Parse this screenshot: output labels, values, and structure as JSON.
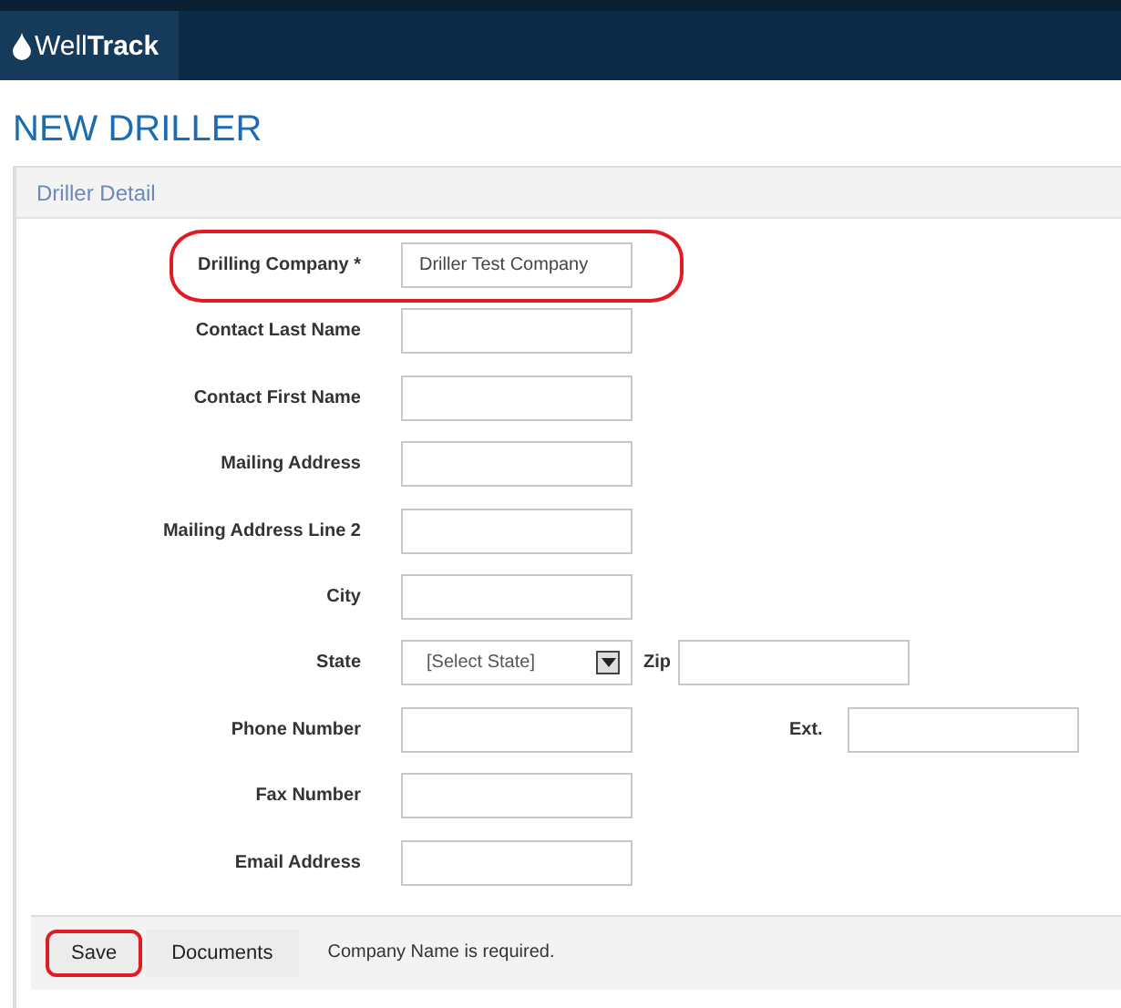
{
  "header": {
    "logo_plain": "Well",
    "logo_bold": "Track"
  },
  "page_title": "NEW DRILLER",
  "panel": {
    "title": "Driller Detail",
    "fields": [
      {
        "label": "Drilling Company *",
        "kind": "text",
        "value": "Driller Test Company",
        "highlighted": true
      },
      {
        "label": "Contact Last Name",
        "kind": "text",
        "highlighted": false
      },
      {
        "label": "Contact First Name",
        "kind": "text",
        "highlighted": false
      },
      {
        "label": "Mailing Address",
        "kind": "text",
        "highlighted": false
      },
      {
        "label": "Mailing Address Line 2",
        "kind": "text",
        "highlighted": false
      },
      {
        "label": "City",
        "kind": "text",
        "highlighted": false
      },
      {
        "label": "State",
        "kind": "select",
        "value": "[Select State]",
        "highlighted": false,
        "extra": {
          "label": "Zip",
          "kind": "near"
        }
      },
      {
        "label": "Phone Number",
        "kind": "text",
        "highlighted": false,
        "extra": {
          "label": "Ext.",
          "kind": "far"
        }
      },
      {
        "label": "Fax Number",
        "kind": "text",
        "highlighted": false
      },
      {
        "label": "Email Address",
        "kind": "text",
        "highlighted": false
      }
    ],
    "buttons": [
      {
        "label": "Save",
        "highlighted": true
      },
      {
        "label": "Documents",
        "highlighted": false
      }
    ],
    "message": "Company Name is required."
  }
}
